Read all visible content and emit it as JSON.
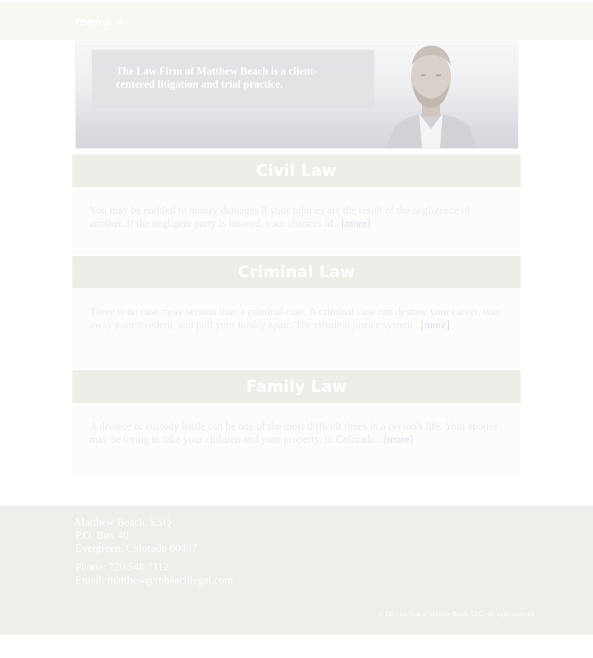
{
  "nav": {
    "menu_label": "menu",
    "menu_plus": "+"
  },
  "hero": {
    "tagline": "The Law Firm of Matthew Beach is a client-centered litigation and trial practice."
  },
  "sections": [
    {
      "title": "Civil Law",
      "text": "You may be entitled to money damages if your injuries are the result of the negligence of another. If the negligent party is insured, your chances of...",
      "more": "[more]"
    },
    {
      "title": "Criminal Law",
      "text": "There is no case more serious than a criminal case. A criminal case can destroy your career, take away your freedom, and pull your family apart. The criminal justice system...",
      "more": "[more]"
    },
    {
      "title": "Family Law",
      "text": "A divorce or custody battle can be one of the most difficult times in a person's life. Your spouse may be trying to take your children and your property. In Colorado...",
      "more": "[more]"
    }
  ],
  "footer": {
    "name": "Matthew Beach, ESQ",
    "address1": "P.O. Box 40",
    "address2": "Evergreen, Colorado 80437",
    "phone_label": "Phone:",
    "phone": "720.548.7112",
    "email_label": "Email:",
    "email": "matthew@mbeachlegal.com",
    "copyright": "© The Law Firm of Matthew Beach, LLC - All rights reserved"
  }
}
